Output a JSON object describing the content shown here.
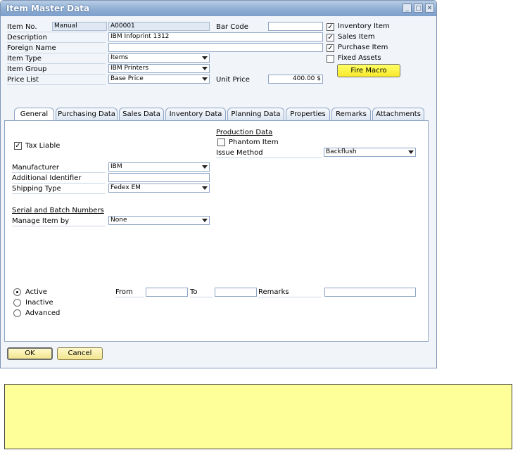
{
  "window": {
    "title": "Item Master Data"
  },
  "header": {
    "item_no_label": "Item No.",
    "item_no_series": "Manual",
    "item_no_value": "A00001",
    "description_label": "Description",
    "description_value": "IBM Infoprint 1312",
    "foreign_name_label": "Foreign Name",
    "foreign_name_value": "",
    "item_type_label": "Item Type",
    "item_type_value": "Items",
    "item_group_label": "Item Group",
    "item_group_value": "IBM Printers",
    "price_list_label": "Price List",
    "price_list_value": "Base Price",
    "bar_code_label": "Bar Code",
    "bar_code_value": "",
    "unit_price_label": "Unit Price",
    "unit_price_value": "400.00 $"
  },
  "flags": {
    "inventory_item": {
      "label": "Inventory Item",
      "checked": true
    },
    "sales_item": {
      "label": "Sales Item",
      "checked": true
    },
    "purchase_item": {
      "label": "Purchase Item",
      "checked": true
    },
    "fixed_assets": {
      "label": "Fixed Assets",
      "checked": false
    }
  },
  "fire_macro_label": "Fire Macro",
  "tabs": [
    {
      "label": "General",
      "active": true
    },
    {
      "label": "Purchasing Data"
    },
    {
      "label": "Sales Data"
    },
    {
      "label": "Inventory Data"
    },
    {
      "label": "Planning Data"
    },
    {
      "label": "Properties"
    },
    {
      "label": "Remarks"
    },
    {
      "label": "Attachments"
    }
  ],
  "general": {
    "tax_liable_label": "Tax Liable",
    "manufacturer_label": "Manufacturer",
    "manufacturer_value": "IBM",
    "additional_identifier_label": "Additional Identifier",
    "additional_identifier_value": "",
    "shipping_type_label": "Shipping Type",
    "shipping_type_value": "Fedex EM",
    "serial_batch_heading": "Serial and Batch Numbers",
    "manage_item_by_label": "Manage Item by",
    "manage_item_by_value": "None",
    "production_heading": "Production Data",
    "phantom_item_label": "Phantom Item",
    "issue_method_label": "Issue Method",
    "issue_method_value": "Backflush",
    "status": {
      "active_label": "Active",
      "inactive_label": "Inactive",
      "advanced_label": "Advanced",
      "from_label": "From",
      "to_label": "To",
      "remarks_label": "Remarks"
    }
  },
  "footer": {
    "ok_label": "OK",
    "cancel_label": "Cancel"
  },
  "colors": {
    "title_bar": "#8eaed3",
    "window_bg": "#f1f5fa",
    "macro_button": "#ffff33",
    "note_area": "#ffff99"
  }
}
